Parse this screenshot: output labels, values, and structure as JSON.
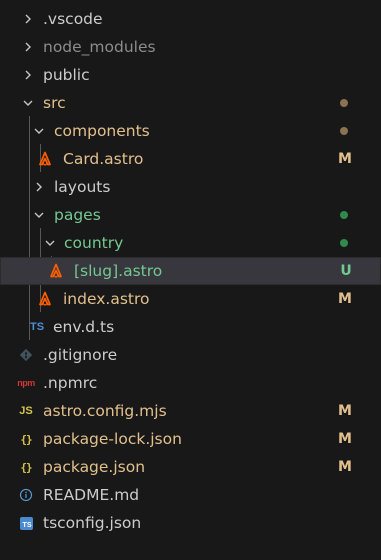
{
  "explorer": {
    "items": [
      {
        "label": ".vscode"
      },
      {
        "label": "node_modules"
      },
      {
        "label": "public"
      },
      {
        "label": "src"
      },
      {
        "label": "components"
      },
      {
        "label": "Card.astro",
        "status": "M"
      },
      {
        "label": "layouts"
      },
      {
        "label": "pages"
      },
      {
        "label": "country"
      },
      {
        "label": "[slug].astro",
        "status": "U"
      },
      {
        "label": "index.astro",
        "status": "M"
      },
      {
        "label": "env.d.ts",
        "icon_text": "TS"
      },
      {
        "label": ".gitignore"
      },
      {
        "label": ".npmrc",
        "icon_text": "npm"
      },
      {
        "label": "astro.config.mjs",
        "status": "M",
        "icon_text": "JS"
      },
      {
        "label": "package-lock.json",
        "status": "M",
        "icon_text": "{}"
      },
      {
        "label": "package.json",
        "status": "M",
        "icon_text": "{}"
      },
      {
        "label": "README.md"
      },
      {
        "label": "tsconfig.json",
        "icon_text": "TS"
      }
    ]
  },
  "colors": {
    "background": "#181818",
    "selected_row": "#37373d",
    "default_text": "#cccccc",
    "dimmed_text": "#8c8c8c",
    "modified": "#e2c08d",
    "untracked": "#73c991",
    "astro_orange": "#ff5d01",
    "dot_modified": "#8a7353",
    "dot_untracked": "#2f8a4c"
  },
  "icons": {
    "folder_collapsed": "chevron-right-icon",
    "folder_expanded": "chevron-down-icon",
    "astro": "astro-icon",
    "typescript": "typescript-icon",
    "git": "git-icon",
    "npm": "npm-icon",
    "javascript": "javascript-icon",
    "json": "json-icon",
    "info": "info-icon",
    "tsconfig": "tsconfig-icon"
  }
}
